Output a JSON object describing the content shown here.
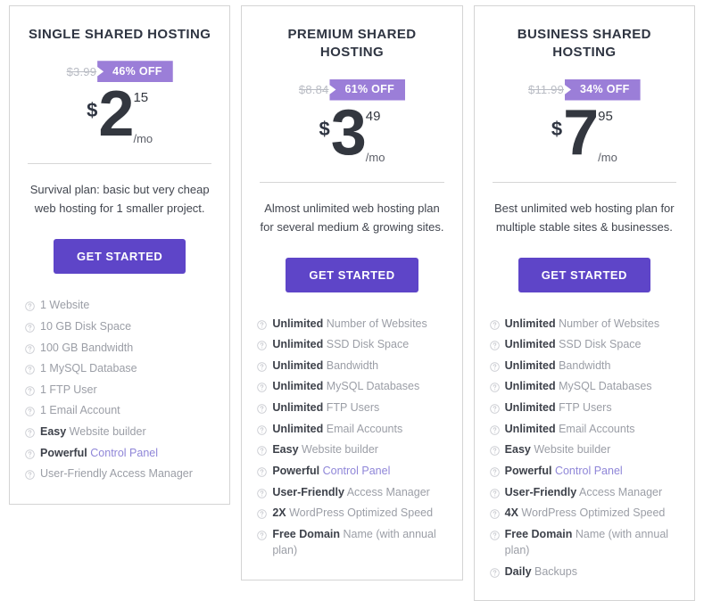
{
  "icons": {
    "help": "help-circle-icon"
  },
  "colors": {
    "badge_purple": "#9b7ed8",
    "cta_purple": "#5e45c8",
    "title_dark": "#2f3542",
    "feature_gray": "#9b9ea6",
    "link_purple": "#8f86d8",
    "card_border": "#d4d4d4"
  },
  "plans": [
    {
      "title": "SINGLE SHARED HOSTING",
      "old_price": "$3.99",
      "discount": "46% OFF",
      "currency": "$",
      "price": "2",
      "cents": "15",
      "period": "/mo",
      "description": "Survival plan: basic but very cheap web hosting for 1 smaller project.",
      "cta": "GET STARTED",
      "features": [
        {
          "strong": "",
          "rest": "1 Website",
          "link": ""
        },
        {
          "strong": "",
          "rest": "10 GB Disk Space",
          "link": ""
        },
        {
          "strong": "",
          "rest": "100 GB Bandwidth",
          "link": ""
        },
        {
          "strong": "",
          "rest": "1 MySQL Database",
          "link": ""
        },
        {
          "strong": "",
          "rest": "1 FTP User",
          "link": ""
        },
        {
          "strong": "",
          "rest": "1 Email Account",
          "link": ""
        },
        {
          "strong": "Easy",
          "rest": " Website builder",
          "link": ""
        },
        {
          "strong": "Powerful",
          "rest": " ",
          "link": "Control Panel"
        },
        {
          "strong": "",
          "rest": "User-Friendly Access Manager",
          "link": ""
        }
      ]
    },
    {
      "title": "PREMIUM SHARED HOSTING",
      "old_price": "$8.84",
      "discount": "61% OFF",
      "currency": "$",
      "price": "3",
      "cents": "49",
      "period": "/mo",
      "description": "Almost unlimited web hosting plan for several medium & growing sites.",
      "cta": "GET STARTED",
      "features": [
        {
          "strong": "Unlimited",
          "rest": " Number of Websites",
          "link": ""
        },
        {
          "strong": "Unlimited",
          "rest": " SSD Disk Space",
          "link": ""
        },
        {
          "strong": "Unlimited",
          "rest": " Bandwidth",
          "link": ""
        },
        {
          "strong": "Unlimited",
          "rest": " MySQL Databases",
          "link": ""
        },
        {
          "strong": "Unlimited",
          "rest": " FTP Users",
          "link": ""
        },
        {
          "strong": "Unlimited",
          "rest": " Email Accounts",
          "link": ""
        },
        {
          "strong": "Easy",
          "rest": " Website builder",
          "link": ""
        },
        {
          "strong": "Powerful",
          "rest": " ",
          "link": "Control Panel"
        },
        {
          "strong": "User-Friendly",
          "rest": " Access Manager",
          "link": ""
        },
        {
          "strong": "2X",
          "rest": " WordPress Optimized Speed",
          "link": ""
        },
        {
          "strong": "Free Domain",
          "rest": " Name (with annual plan)",
          "link": ""
        }
      ]
    },
    {
      "title": "BUSINESS SHARED HOSTING",
      "old_price": "$11.99",
      "discount": "34% OFF",
      "currency": "$",
      "price": "7",
      "cents": "95",
      "period": "/mo",
      "description": "Best unlimited web hosting plan for multiple stable sites & businesses.",
      "cta": "GET STARTED",
      "features": [
        {
          "strong": "Unlimited",
          "rest": " Number of Websites",
          "link": ""
        },
        {
          "strong": "Unlimited",
          "rest": " SSD Disk Space",
          "link": ""
        },
        {
          "strong": "Unlimited",
          "rest": " Bandwidth",
          "link": ""
        },
        {
          "strong": "Unlimited",
          "rest": " MySQL Databases",
          "link": ""
        },
        {
          "strong": "Unlimited",
          "rest": " FTP Users",
          "link": ""
        },
        {
          "strong": "Unlimited",
          "rest": " Email Accounts",
          "link": ""
        },
        {
          "strong": "Easy",
          "rest": " Website builder",
          "link": ""
        },
        {
          "strong": "Powerful",
          "rest": " ",
          "link": "Control Panel"
        },
        {
          "strong": "User-Friendly",
          "rest": " Access Manager",
          "link": ""
        },
        {
          "strong": "4X",
          "rest": " WordPress Optimized Speed",
          "link": ""
        },
        {
          "strong": "Free Domain",
          "rest": " Name (with annual plan)",
          "link": ""
        },
        {
          "strong": "Daily",
          "rest": " Backups",
          "link": ""
        }
      ]
    }
  ]
}
